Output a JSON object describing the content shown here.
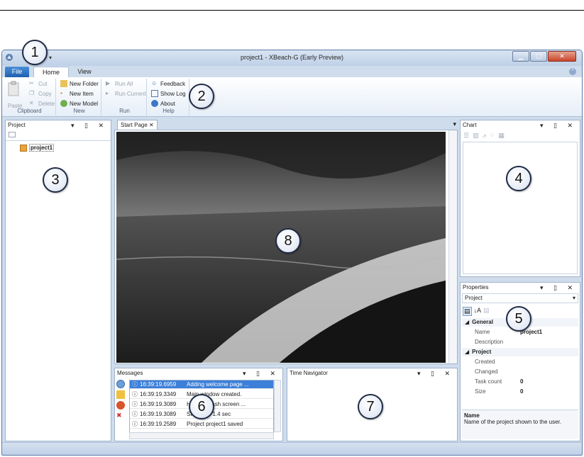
{
  "window": {
    "title": "project1 - XBeach-G (Early Preview)"
  },
  "ribbon_tabs": [
    "File",
    "Home",
    "View"
  ],
  "ribbon": {
    "clipboard": {
      "label": "Clipboard",
      "paste": "Paste",
      "cut": "Cut",
      "copy": "Copy",
      "delete": "Delete"
    },
    "new": {
      "label": "New",
      "new_folder": "New Folder",
      "new_item": "New Item",
      "new_model": "New Model"
    },
    "run": {
      "label": "Run",
      "run_all": "Run All",
      "run_current": "Run Current"
    },
    "help": {
      "label": "Help",
      "feedback": "Feedback",
      "show_log": "Show Log",
      "about": "About"
    }
  },
  "project_panel": {
    "title": "Project",
    "tree": [
      "project1"
    ]
  },
  "start_page": {
    "tab_label": "Start Page"
  },
  "chart_panel": {
    "title": "Chart"
  },
  "properties_panel": {
    "title": "Properties",
    "selected_object": "Project",
    "rows": [
      {
        "kind": "category",
        "name": "General"
      },
      {
        "kind": "prop",
        "name": "Name",
        "value": "project1"
      },
      {
        "kind": "prop",
        "name": "Description",
        "value": ""
      },
      {
        "kind": "category",
        "name": "Project"
      },
      {
        "kind": "prop",
        "name": "Created",
        "value": ""
      },
      {
        "kind": "prop",
        "name": "Changed",
        "value": ""
      },
      {
        "kind": "prop",
        "name": "Task count",
        "value": "0"
      },
      {
        "kind": "prop",
        "name": "Size",
        "value": "0"
      }
    ],
    "description_title": "Name",
    "description_text": "Name of the project shown to the user."
  },
  "messages_panel": {
    "title": "Messages",
    "rows": [
      {
        "time": "16:39:19.6959",
        "text": "Adding welcome page ..."
      },
      {
        "time": "16:39:19.3349",
        "text": "Main window created."
      },
      {
        "time": "16:39:19.3089",
        "text": "Hiding splash screen ..."
      },
      {
        "time": "16:39:19.3089",
        "text": "Started in 1.4 sec"
      },
      {
        "time": "16:39:19.2589",
        "text": "Project project1 saved"
      }
    ]
  },
  "time_navigator": {
    "title": "Time Navigator"
  },
  "callouts": [
    "1",
    "2",
    "3",
    "4",
    "5",
    "6",
    "7",
    "8"
  ],
  "colors": {
    "accent": "#1f5fae",
    "selection": "#3b7fd9",
    "chrome": "#cfdcec"
  }
}
